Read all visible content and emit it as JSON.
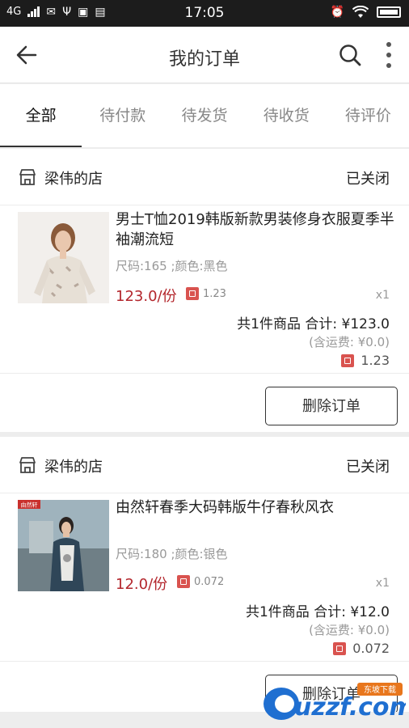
{
  "status_bar": {
    "network": "4G",
    "time": "17:05"
  },
  "header": {
    "title": "我的订单"
  },
  "tabs": [
    {
      "label": "全部",
      "active": true
    },
    {
      "label": "待付款",
      "active": false
    },
    {
      "label": "待发货",
      "active": false
    },
    {
      "label": "待收货",
      "active": false
    },
    {
      "label": "待评价",
      "active": false
    }
  ],
  "orders": [
    {
      "shop_name": "梁伟的店",
      "status": "已关闭",
      "product": {
        "title": "男士T恤2019韩版新款男装修身衣服夏季半袖潮流短",
        "spec": "尺码:165 ;颜色:黑色",
        "price": "123.0/份",
        "coupon": "1.23",
        "qty": "x1"
      },
      "summary": {
        "total": "共1件商品  合计: ¥123.0",
        "shipping": "(含运费: ¥0.0)",
        "coupon": "1.23"
      },
      "action": "删除订单"
    },
    {
      "shop_name": "梁伟的店",
      "status": "已关闭",
      "product": {
        "title": "由然轩春季大码韩版牛仔春秋风衣",
        "badge": "由然轩",
        "spec": "尺码:180 ;颜色:银色",
        "price": "12.0/份",
        "coupon": "0.072",
        "qty": "x1"
      },
      "summary": {
        "total": "共1件商品  合计: ¥12.0",
        "shipping": "(含运费: ¥0.0)",
        "coupon": "0.072"
      },
      "action": "删除订单"
    }
  ],
  "watermark": {
    "text": "uzzf.com",
    "badge": "东坡下载"
  },
  "colors": {
    "price_red": "#b3262c",
    "coupon_red": "#d9534f",
    "status_bar": "#1c1c1c"
  }
}
